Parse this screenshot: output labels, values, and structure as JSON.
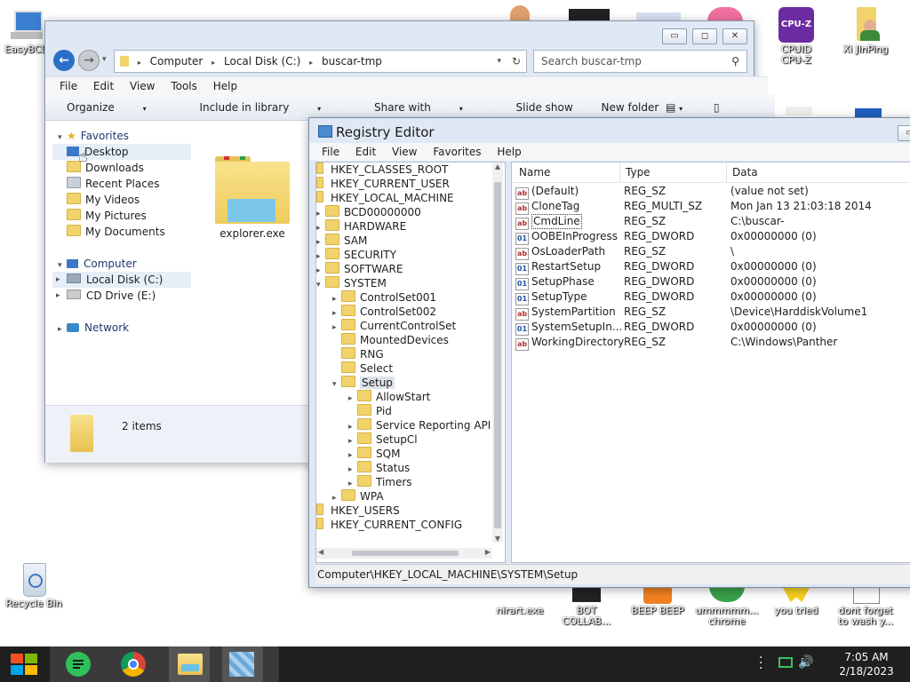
{
  "desktop": {
    "icons": [
      {
        "label": "EasyBCD"
      },
      {
        "label": "CPUID\nCPU-Z"
      },
      {
        "label": "Xi JinPing"
      },
      {
        "label": "Recycle Bin"
      },
      {
        "label": "nirart.exe"
      },
      {
        "label": "BOT\nCOLLAB..."
      },
      {
        "label": "BEEP BEEP"
      },
      {
        "label": "ummmmm...\nchrome"
      },
      {
        "label": "you tried"
      },
      {
        "label": "dont forget\nto wash y..."
      }
    ]
  },
  "explorer": {
    "address": {
      "crumbs": [
        "Computer",
        "Local Disk (C:)",
        "buscar-tmp"
      ]
    },
    "search_placeholder": "Search buscar-tmp",
    "menu": [
      "File",
      "Edit",
      "View",
      "Tools",
      "Help"
    ],
    "toolbar": {
      "organize": "Organize",
      "include": "Include in library",
      "share": "Share with",
      "slideshow": "Slide show",
      "newfolder": "New folder"
    },
    "nav": {
      "favorites": "Favorites",
      "fav_items": [
        "Desktop",
        "Downloads",
        "Recent Places",
        "My Videos",
        "My Pictures",
        "My Documents"
      ],
      "computer": "Computer",
      "comp_items": [
        "Local Disk (C:)",
        "CD Drive (E:)"
      ],
      "network": "Network"
    },
    "file": {
      "name": "explorer.exe"
    },
    "status": "2 items"
  },
  "regedit": {
    "title": "Registry Editor",
    "menu": [
      "File",
      "Edit",
      "View",
      "Favorites",
      "Help"
    ],
    "tree": [
      {
        "label": "HKEY_CLASSES_ROOT"
      },
      {
        "label": "HKEY_CURRENT_USER"
      },
      {
        "label": "HKEY_LOCAL_MACHINE"
      },
      {
        "label": "BCD00000000"
      },
      {
        "label": "HARDWARE"
      },
      {
        "label": "SAM"
      },
      {
        "label": "SECURITY"
      },
      {
        "label": "SOFTWARE"
      },
      {
        "label": "SYSTEM"
      },
      {
        "label": "ControlSet001"
      },
      {
        "label": "ControlSet002"
      },
      {
        "label": "CurrentControlSet"
      },
      {
        "label": "MountedDevices"
      },
      {
        "label": "RNG"
      },
      {
        "label": "Select"
      },
      {
        "label": "Setup"
      },
      {
        "label": "AllowStart"
      },
      {
        "label": "Pid"
      },
      {
        "label": "Service Reporting API"
      },
      {
        "label": "SetupCl"
      },
      {
        "label": "SQM"
      },
      {
        "label": "Status"
      },
      {
        "label": "Timers"
      },
      {
        "label": "WPA"
      },
      {
        "label": "HKEY_USERS"
      },
      {
        "label": "HKEY_CURRENT_CONFIG"
      }
    ],
    "columns": {
      "name": "Name",
      "type": "Type",
      "data": "Data"
    },
    "values": [
      {
        "name": "(Default)",
        "type": "REG_SZ",
        "data": "(value not set)",
        "icon": "ab"
      },
      {
        "name": "CloneTag",
        "type": "REG_MULTI_SZ",
        "data": "Mon Jan 13 21:03:18 2014",
        "icon": "ab"
      },
      {
        "name": "CmdLine",
        "type": "REG_SZ",
        "data": "C:\\buscar-",
        "icon": "ab"
      },
      {
        "name": "OOBEInProgress",
        "type": "REG_DWORD",
        "data": "0x00000000 (0)",
        "icon": "01"
      },
      {
        "name": "OsLoaderPath",
        "type": "REG_SZ",
        "data": "\\",
        "icon": "ab"
      },
      {
        "name": "RestartSetup",
        "type": "REG_DWORD",
        "data": "0x00000000 (0)",
        "icon": "01"
      },
      {
        "name": "SetupPhase",
        "type": "REG_DWORD",
        "data": "0x00000000 (0)",
        "icon": "01"
      },
      {
        "name": "SetupType",
        "type": "REG_DWORD",
        "data": "0x00000000 (0)",
        "icon": "01"
      },
      {
        "name": "SystemPartition",
        "type": "REG_SZ",
        "data": "\\Device\\HarddiskVolume1",
        "icon": "ab"
      },
      {
        "name": "SystemSetupIn...",
        "type": "REG_DWORD",
        "data": "0x00000000 (0)",
        "icon": "01"
      },
      {
        "name": "WorkingDirectory",
        "type": "REG_SZ",
        "data": "C:\\Windows\\Panther",
        "icon": "ab"
      }
    ],
    "statusbar": "Computer\\HKEY_LOCAL_MACHINE\\SYSTEM\\Setup"
  },
  "taskbar": {
    "time": "7:05 AM",
    "date": "2/18/2023"
  }
}
